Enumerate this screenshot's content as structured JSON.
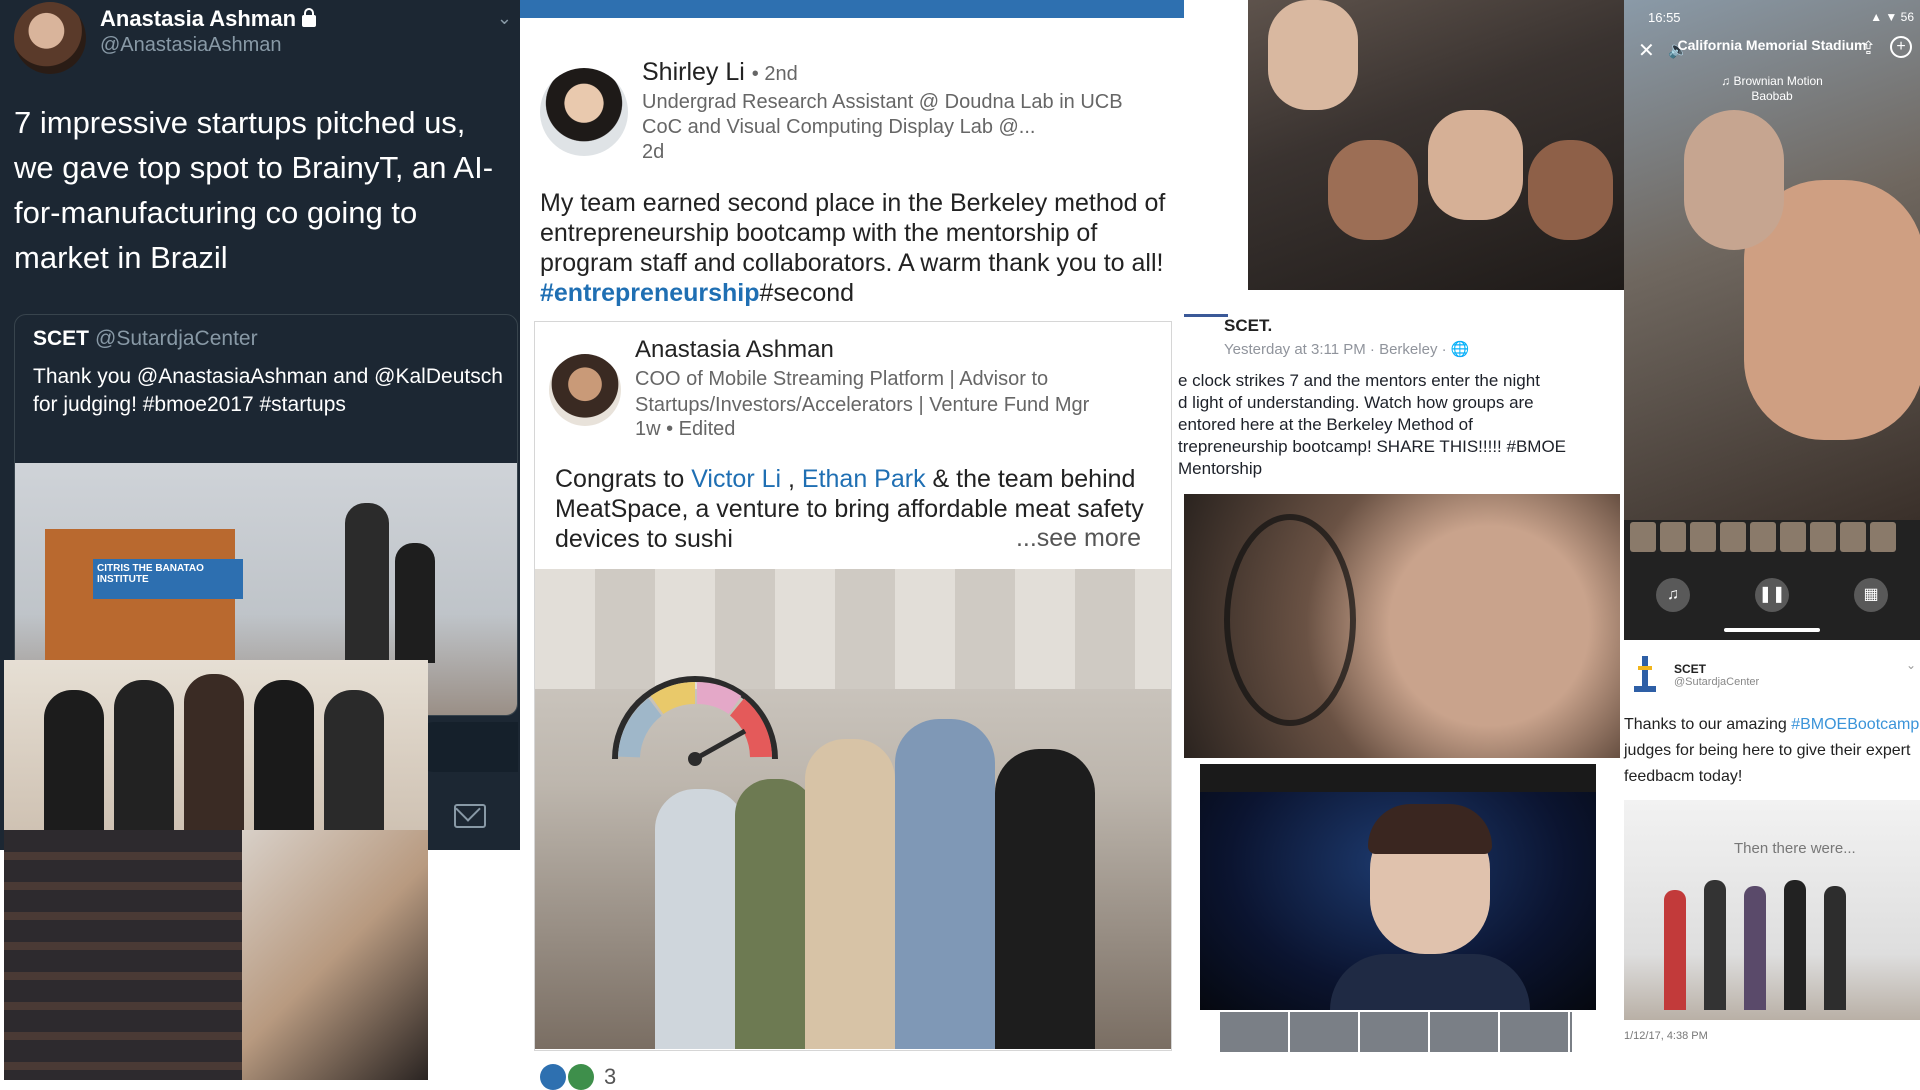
{
  "twitter": {
    "name": "Anastasia Ashman",
    "handle": "@AnastasiaAshman",
    "tweet": "7 impressive startups pitched us, we gave top spot to BrainyT, an AI-for-manufacturing co going to market in Brazil",
    "quote": {
      "name": "SCET",
      "handle": "@SutardjaCenter",
      "text": "Thank you @AnastasiaAshman and @KalDeutsch for judging! #bmoe2017 #startups"
    },
    "podium_sign": "CITRIS THE BANATAO INSTITUTE"
  },
  "linkedin": {
    "post1": {
      "name": "Shirley Li",
      "degree": "• 2nd",
      "headline": "Undergrad Research Assistant @ Doudna Lab in UCB CoC and Visual Computing Display Lab @...",
      "time": "2d",
      "text": "My team earned second place in the Berkeley method of entrepreneurship bootcamp with the mentorship of program staff and collaborators. A warm thank you to all! ",
      "hashtag": "#entrepreneurship",
      "text_after": "#second"
    },
    "post2": {
      "name": "Anastasia Ashman",
      "headline": "COO of Mobile Streaming Platform | Advisor to Startups/Investors/Accelerators | Venture Fund Mgr",
      "meta": "1w • Edited",
      "text_before": "Congrats to ",
      "mention1": "Victor Li",
      "comma": " , ",
      "mention2": "Ethan Park",
      "text_after": " & the team behind MeatSpace, a venture to bring affordable meat safety devices to sushi",
      "see_more": "...see more"
    },
    "reactions_count": "3",
    "colors": {
      "link": "#1f6fb3",
      "topbar": "#2e70b0"
    }
  },
  "facebook": {
    "page": "SCET.",
    "meta": "Yesterday at 3:11 PM · Berkeley · 🌐",
    "body": "e clock strikes 7 and the mentors enter the night\nd light of understanding. Watch how groups are\nentored here at the Berkeley Method of\ntrepreneurship bootcamp! SHARE THIS!!!!! #BMOE\nMentorship"
  },
  "instagram": {
    "time": "16:55",
    "status": "▲ ▼ 56",
    "location": "California Memorial Stadium",
    "song": "♫ Brownian Motion",
    "artist": "Baobab"
  },
  "scet_tweet": {
    "name": "SCET",
    "handle": "@SutardjaCenter",
    "text_before": "Thanks to our amazing ",
    "hashtag": "#BMOEBootcamp",
    "text_after": " judges for being here to give their expert feedbacm today!",
    "slide_text": "Then there were...",
    "timestamp": "1/12/17, 4:38 PM"
  }
}
